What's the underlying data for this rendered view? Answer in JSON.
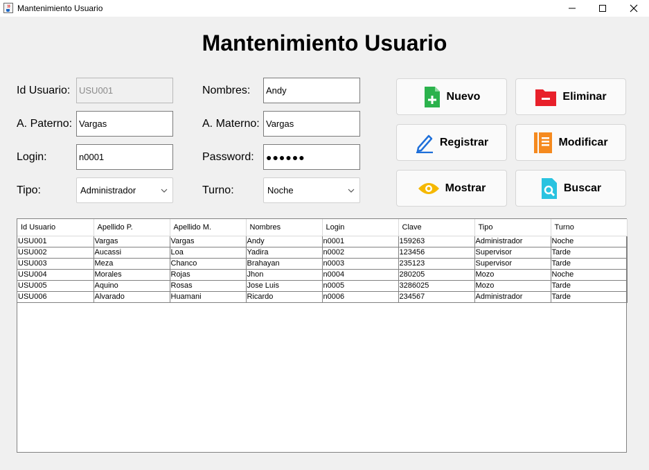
{
  "window": {
    "title": "Mantenimiento Usuario",
    "icon": "java-cup-icon"
  },
  "heading": "Mantenimiento Usuario",
  "form": {
    "id_usuario": {
      "label": "Id Usuario:",
      "value": "USU001"
    },
    "nombres": {
      "label": "Nombres:",
      "value": "Andy"
    },
    "a_paterno": {
      "label": "A. Paterno:",
      "value": "Vargas"
    },
    "a_materno": {
      "label": "A. Materno:",
      "value": "Vargas"
    },
    "login": {
      "label": "Login:",
      "value": "n0001"
    },
    "password": {
      "label": "Password:",
      "value": "●●●●●●"
    },
    "tipo": {
      "label": "Tipo:",
      "value": "Administrador"
    },
    "turno": {
      "label": "Turno:",
      "value": "Noche"
    }
  },
  "buttons": {
    "nuevo": {
      "label": "Nuevo",
      "icon": "new-document-icon",
      "color": "#2bb24c"
    },
    "eliminar": {
      "label": "Eliminar",
      "icon": "folder-remove-icon",
      "color": "#e8202a"
    },
    "registrar": {
      "label": "Registrar",
      "icon": "pencil-icon",
      "color": "#1e6fd9"
    },
    "modificar": {
      "label": "Modificar",
      "icon": "notebook-icon",
      "color": "#f58a1f"
    },
    "mostrar": {
      "label": "Mostrar",
      "icon": "eye-icon",
      "color": "#f5b800"
    },
    "buscar": {
      "label": "Buscar",
      "icon": "search-document-icon",
      "color": "#29c3e0"
    }
  },
  "table": {
    "columns": [
      "Id Usuario",
      "Apellido P.",
      "Apellido M.",
      "Nombres",
      "Login",
      "Clave",
      "Tipo",
      "Turno"
    ],
    "rows": [
      [
        "USU001",
        "Vargas",
        "Vargas",
        "Andy",
        "n0001",
        "159263",
        "Administrador",
        "Noche"
      ],
      [
        "USU002",
        "Aucassi",
        "Loa",
        "Yadira",
        "n0002",
        "123456",
        "Supervisor",
        "Tarde"
      ],
      [
        "USU003",
        "Meza",
        "Chanco",
        "Brahayan",
        "n0003",
        "235123",
        "Supervisor",
        "Tarde"
      ],
      [
        "USU004",
        "Morales",
        "Rojas",
        "Jhon",
        "n0004",
        "280205",
        "Mozo",
        "Noche"
      ],
      [
        "USU005",
        "Aquino",
        "Rosas",
        "Jose Luis",
        "n0005",
        "3286025",
        "Mozo",
        "Tarde"
      ],
      [
        "USU006",
        "Alvarado",
        "Huamani",
        "Ricardo",
        "n0006",
        "234567",
        "Administrador",
        "Tarde"
      ]
    ]
  }
}
